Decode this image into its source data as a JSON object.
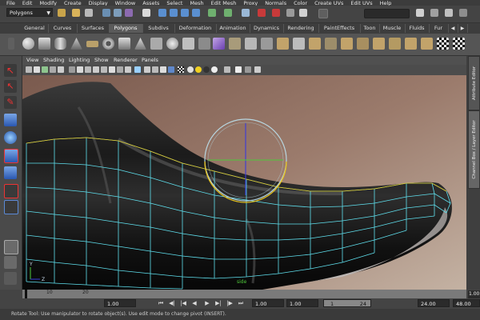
{
  "menubar": {
    "items": [
      "File",
      "Edit",
      "Modify",
      "Create",
      "Display",
      "Window",
      "Assets",
      "Select",
      "Mesh",
      "Edit Mesh",
      "Proxy",
      "Normals",
      "Color",
      "Create UVs",
      "Edit UVs",
      "Help"
    ]
  },
  "status": {
    "mode": "Polygons"
  },
  "shelf_tabs": {
    "items": [
      "General",
      "Curves",
      "Surfaces",
      "Polygons",
      "Subdivs",
      "Deformation",
      "Animation",
      "Dynamics",
      "Rendering",
      "PaintEffects",
      "Toon",
      "Muscle",
      "Fluids",
      "Fur"
    ],
    "active": "Polygons"
  },
  "panel_menu": {
    "items": [
      "View",
      "Shading",
      "Lighting",
      "Show",
      "Renderer",
      "Panels"
    ]
  },
  "viewport": {
    "camera_label": "side",
    "axis_y": "Y",
    "axis_z": "Z"
  },
  "side_tabs": {
    "attribute_editor": "Attribute Editor",
    "channel_box": "Channel Box / Layer Editor"
  },
  "time_slider": {
    "ticks": [
      "10",
      "20"
    ],
    "current_frame": "1.00"
  },
  "range": {
    "start_time": "1.00",
    "playback_start": "1.00",
    "range_min": "1.00",
    "slider_start": "1",
    "slider_end": "24",
    "playback_end": "24.00",
    "end_time": "48.00"
  },
  "help_line": "Rotate Tool: Use manipulator to rotate object(s). Use edit mode to change pivot (INSERT).",
  "colors": {
    "wire": "#5fe0ee",
    "manip_ring": "#b8d6e0",
    "manip_yellow": "#e6c21e",
    "manip_green": "#4ec93a",
    "manip_blue": "#3a3adb"
  },
  "icons": {
    "tools": [
      "select-arrow-icon",
      "lasso-icon",
      "paint-select-icon",
      "move-icon",
      "rotate-icon",
      "scale-icon",
      "manipulator-icon",
      "last-tool-icon"
    ]
  }
}
